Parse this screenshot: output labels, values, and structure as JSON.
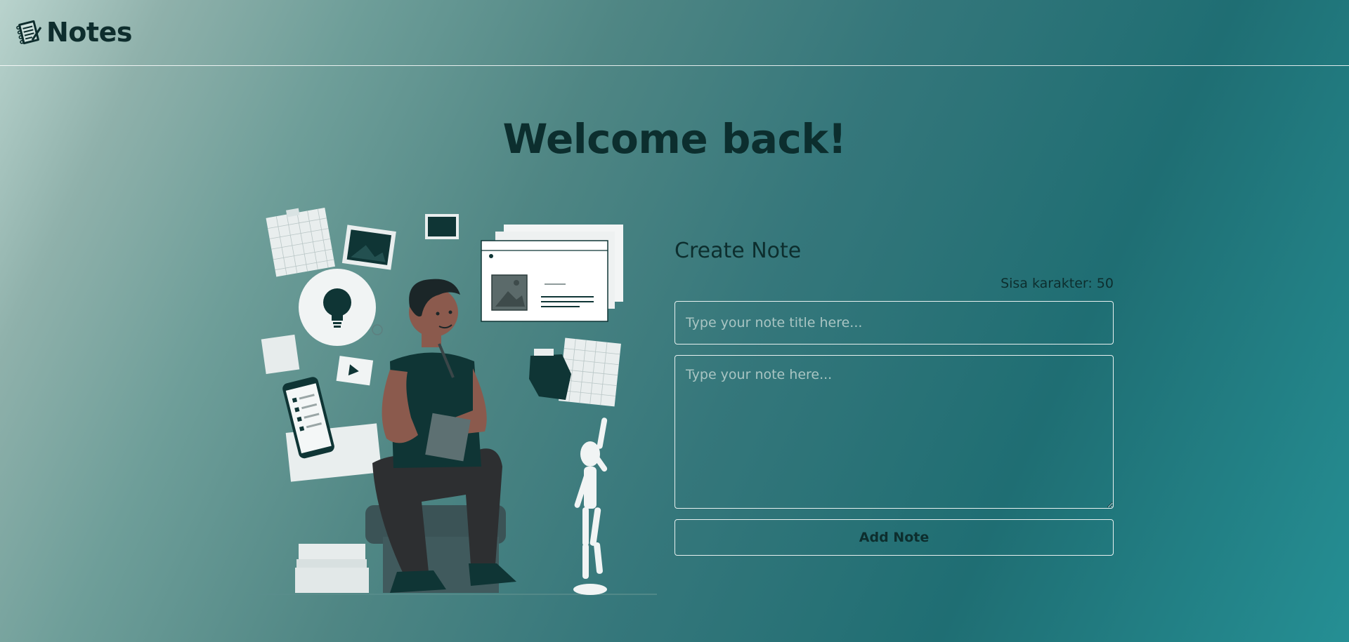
{
  "navbar": {
    "brand_icon": "notepad-icon",
    "brand_text": "Notes"
  },
  "main": {
    "heading": "Welcome back!",
    "illustration": "person-thinking-illustration"
  },
  "form": {
    "title": "Create Note",
    "char_count_text": "Sisa karakter: 50",
    "title_placeholder": "Type your note title here...",
    "body_placeholder": "Type your note here...",
    "submit_label": "Add Note"
  },
  "colors": {
    "text_dark": "#0d2e2e",
    "border": "#e8f1f0",
    "gradient_start": "#b9d3cd",
    "gradient_end": "#258f94"
  }
}
